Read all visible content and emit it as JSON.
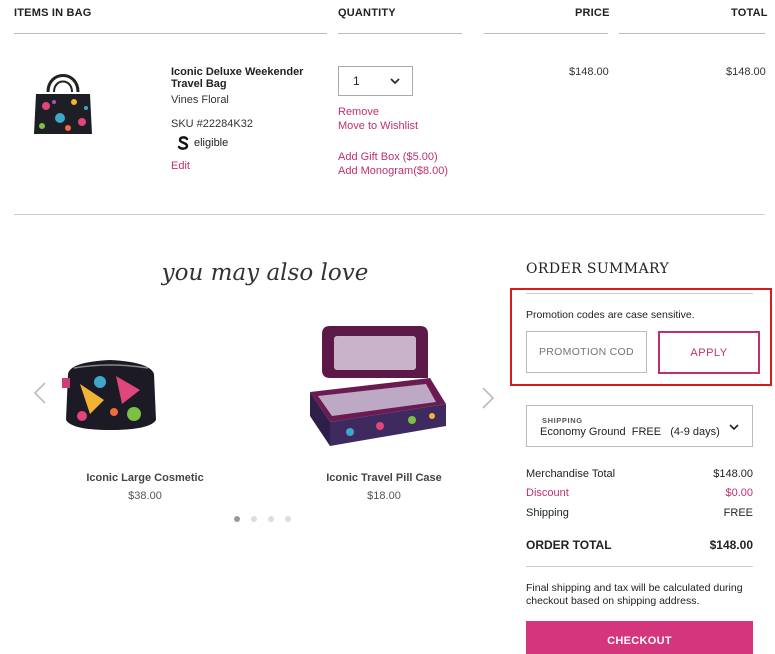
{
  "cart": {
    "headers": {
      "items": "ITEMS IN BAG",
      "quantity": "QUANTITY",
      "price": "PRICE",
      "total": "TOTAL"
    },
    "item": {
      "name": "Iconic Deluxe Weekender Travel Bag",
      "color": "Vines Floral",
      "sku": "SKU #22284K32",
      "eligible": "eligible",
      "edit": "Edit",
      "quantity": "1",
      "remove": "Remove",
      "wishlist": "Move to Wishlist",
      "gift_box": "Add Gift Box ($5.00)",
      "monogram": "Add Monogram($8.00)",
      "price": "$148.00",
      "total": "$148.00"
    }
  },
  "recommendations": {
    "title": "you may also love",
    "items": [
      {
        "name": "Iconic Large Cosmetic",
        "price": "$38.00"
      },
      {
        "name": "Iconic Travel Pill Case",
        "price": "$18.00"
      }
    ],
    "dots": 4,
    "active_dot": 0
  },
  "order_summary": {
    "title": "ORDER SUMMARY",
    "promo_note": "Promotion codes are case sensitive.",
    "promo_placeholder": "PROMOTION CODE",
    "apply": "APPLY",
    "shipping_label": "SHIPPING",
    "shipping_method": "Economy Ground",
    "shipping_cost": "FREE",
    "shipping_days": "(4-9 days)",
    "lines": [
      {
        "label": "Merchandise Total",
        "value": "$148.00"
      },
      {
        "label": "Discount",
        "value": "$0.00"
      },
      {
        "label": "Shipping",
        "value": "FREE"
      }
    ],
    "total_label": "ORDER TOTAL",
    "total_value": "$148.00",
    "final_note": "Final shipping and tax will be calculated during checkout based on shipping address.",
    "checkout": "CHECKOUT"
  },
  "colors": {
    "accent": "#c0306f",
    "checkout": "#d4357d",
    "highlight": "#d51d1d"
  }
}
